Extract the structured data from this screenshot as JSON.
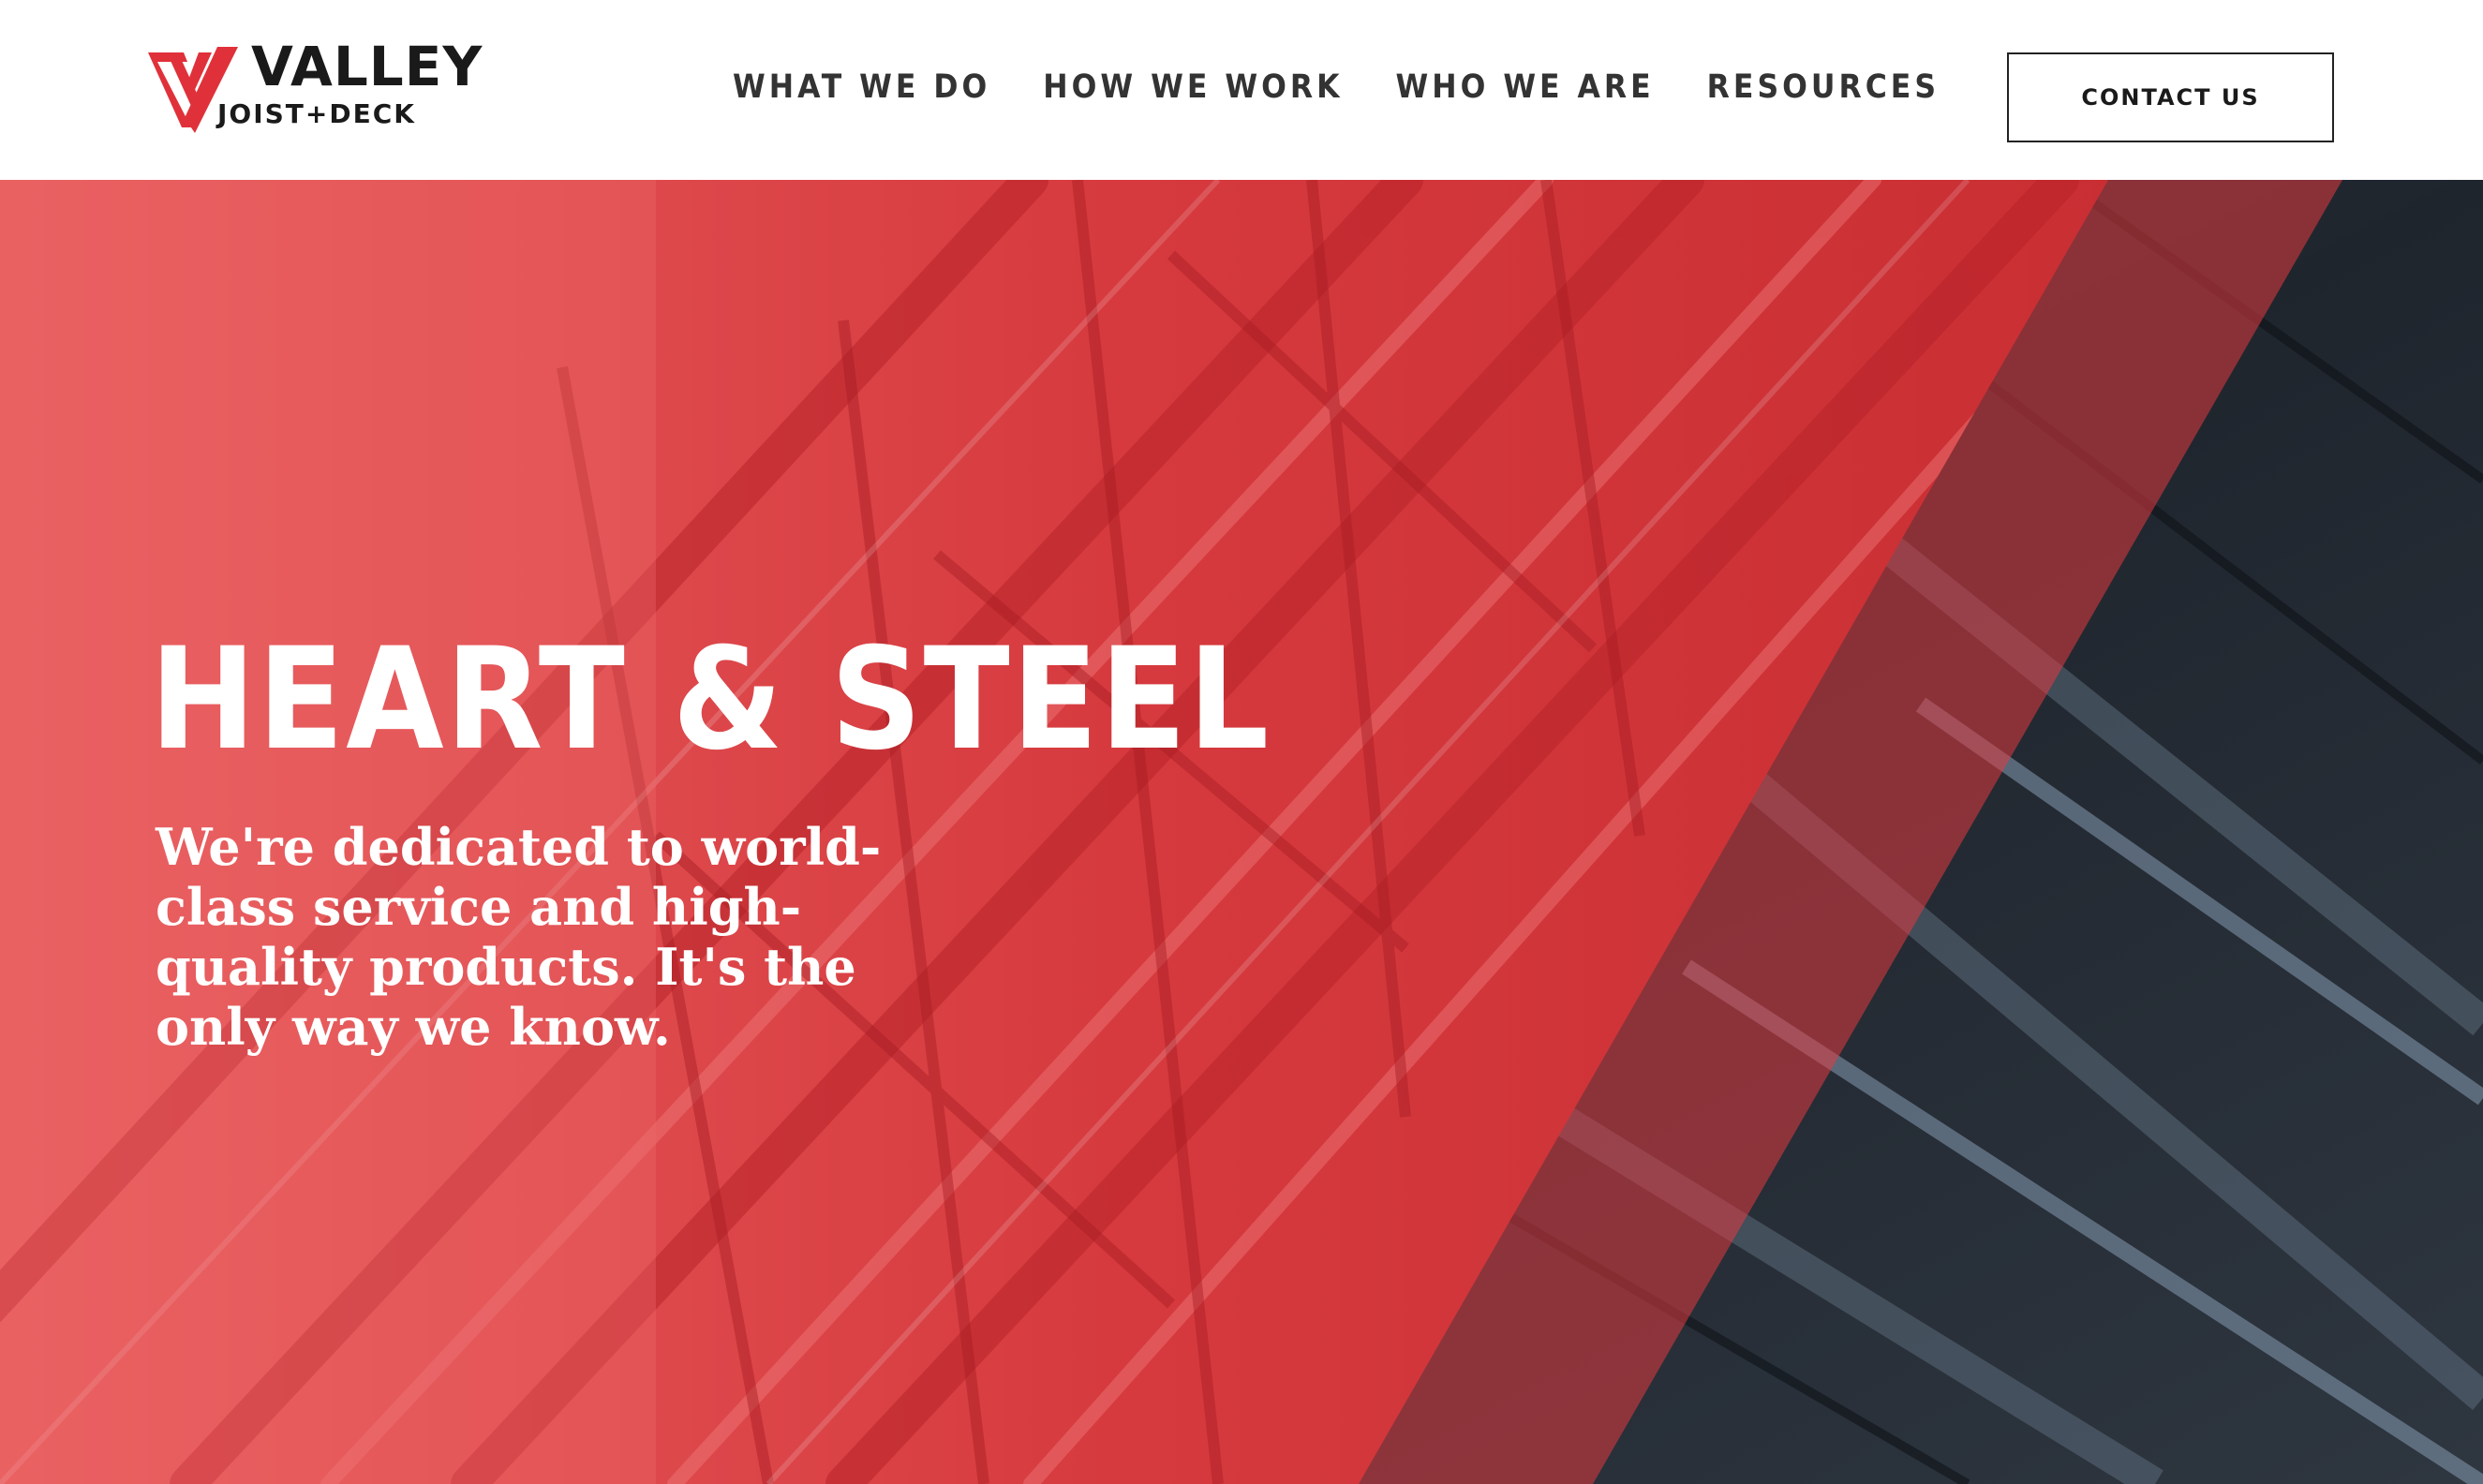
{
  "brand": {
    "name": "VALLEY",
    "tagline": "JOIST+DECK",
    "accent_color": "#e0313a",
    "dark_color": "#1a1a1a"
  },
  "nav": {
    "items": [
      {
        "label": "WHAT WE DO"
      },
      {
        "label": "HOW WE WORK"
      },
      {
        "label": "WHO WE ARE"
      },
      {
        "label": "RESOURCES"
      }
    ],
    "contact_label": "CONTACT US"
  },
  "hero": {
    "title": "HEART & STEEL",
    "text": "We're dedicated to world-class service and high-quality products. It's the only way we know.",
    "overlay_color": "#e23a40",
    "image": "steel-joist-truss-photo"
  }
}
